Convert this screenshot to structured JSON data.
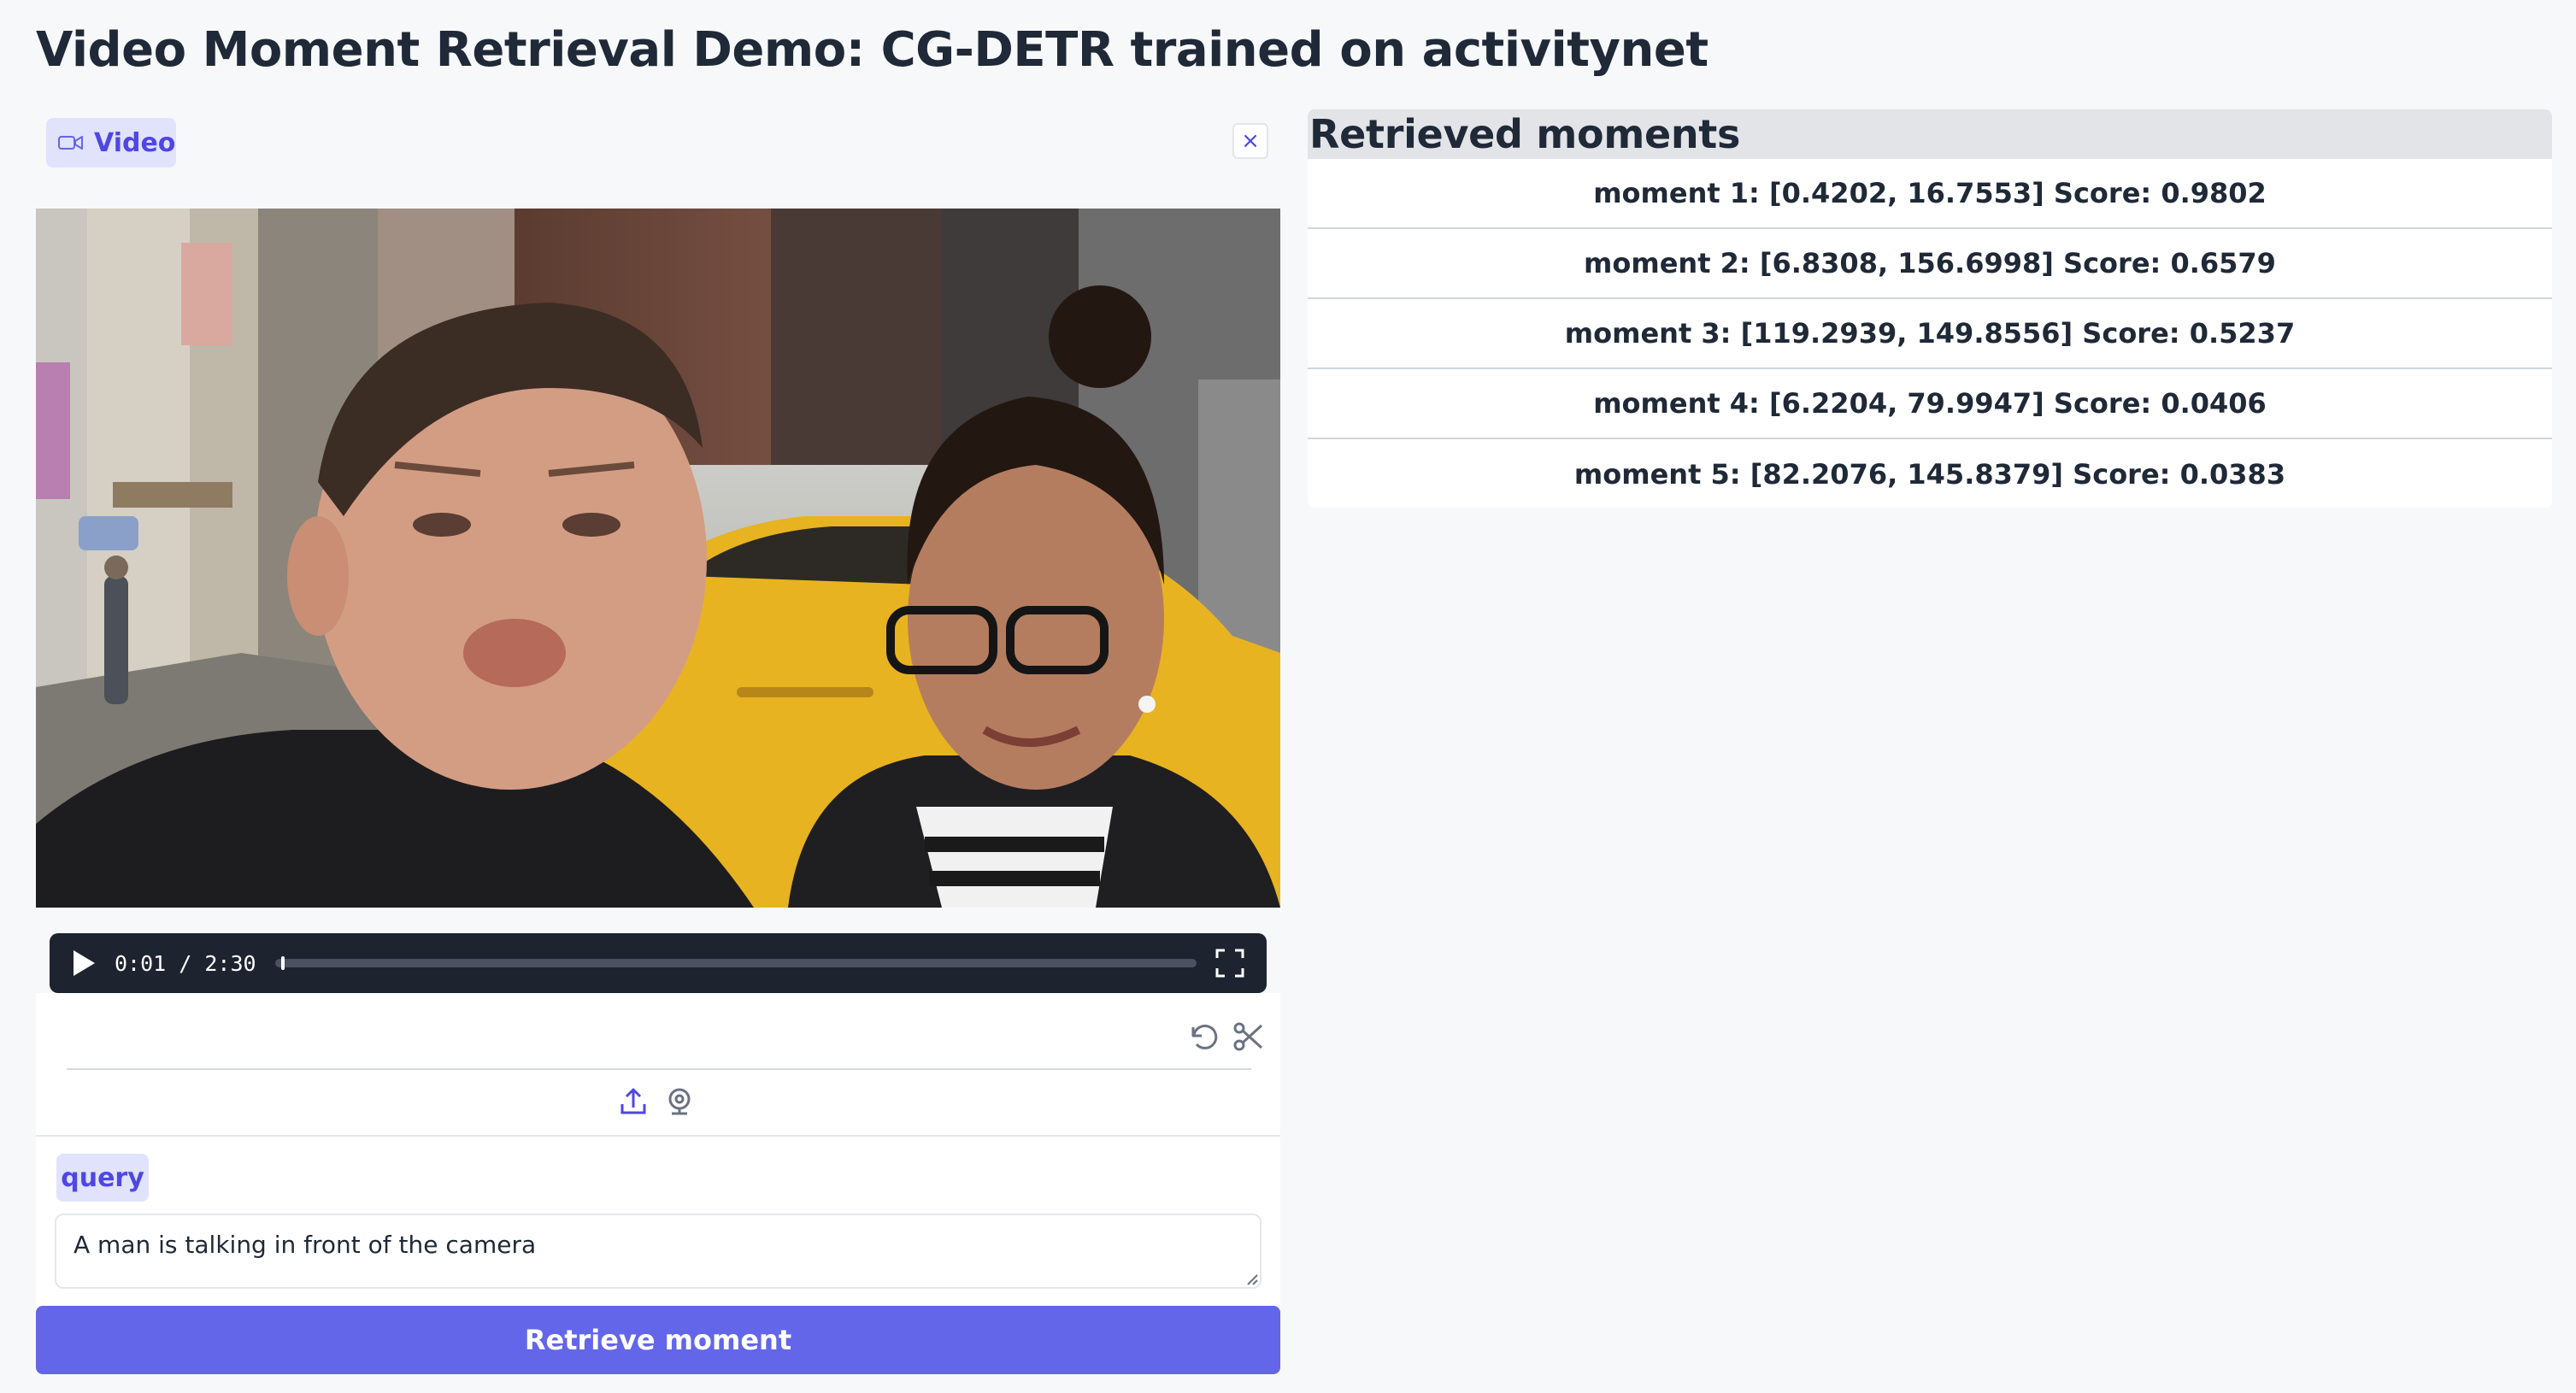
{
  "page": {
    "title": "Video Moment Retrieval Demo: CG-DETR trained on activitynet"
  },
  "video": {
    "label": "Video",
    "clear_symbol": "×",
    "current_time": "0:01",
    "duration": "2:30",
    "time_display": "0:01 / 2:30",
    "progress_fraction": 0.007
  },
  "query": {
    "label": "query",
    "value": "A man is talking in front of the camera"
  },
  "actions": {
    "retrieve_label": "Retrieve moment"
  },
  "results": {
    "header": "Retrieved moments",
    "moments": [
      "moment 1: [0.4202, 16.7553] Score: 0.9802",
      "moment 2: [6.8308, 156.6998] Score: 0.6579",
      "moment 3: [119.2939, 149.8556] Score: 0.5237",
      "moment 4: [6.2204, 79.9947] Score: 0.0406",
      "moment 5: [82.2076, 145.8379] Score: 0.0383"
    ]
  },
  "icons": {
    "video_label": "video-camera-icon",
    "clear": "close-icon",
    "play": "play-icon",
    "fullscreen": "fullscreen-icon",
    "undo": "undo-icon",
    "trim": "scissors-icon",
    "upload": "upload-icon",
    "webcam": "webcam-icon"
  },
  "colors": {
    "accent": "#6366e8",
    "label_bg": "#e0e3fb",
    "label_text": "#4f46e5",
    "controls_bg": "#1e2330"
  }
}
